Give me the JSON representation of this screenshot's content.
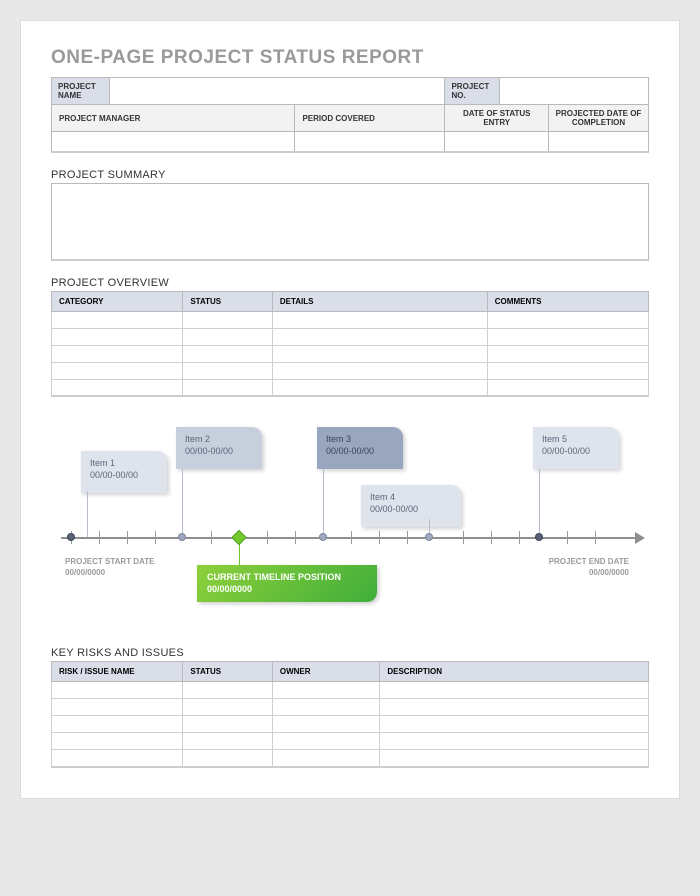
{
  "title": "ONE-PAGE PROJECT STATUS REPORT",
  "top": {
    "projectName": "PROJECT NAME",
    "projectNo": "PROJECT NO.",
    "projectManager": "PROJECT MANAGER",
    "periodCovered": "PERIOD COVERED",
    "dateOfStatus": "DATE OF STATUS ENTRY",
    "projCompletion": "PROJECTED DATE OF COMPLETION",
    "values": {
      "projectName": "",
      "projectNo": "",
      "projectManager": "",
      "periodCovered": "",
      "dateOfStatus": "",
      "projCompletion": ""
    }
  },
  "sections": {
    "summary": "PROJECT SUMMARY",
    "overview": "PROJECT OVERVIEW",
    "risks": "KEY RISKS AND ISSUES"
  },
  "overview": {
    "headers": {
      "category": "CATEGORY",
      "status": "STATUS",
      "details": "DETAILS",
      "comments": "COMMENTS"
    },
    "rows": [
      {
        "category": "",
        "status": "",
        "details": "",
        "comments": ""
      },
      {
        "category": "",
        "status": "",
        "details": "",
        "comments": ""
      },
      {
        "category": "",
        "status": "",
        "details": "",
        "comments": ""
      },
      {
        "category": "",
        "status": "",
        "details": "",
        "comments": ""
      },
      {
        "category": "",
        "status": "",
        "details": "",
        "comments": ""
      }
    ]
  },
  "timeline": {
    "items": [
      {
        "name": "Item 1",
        "range": "00/00-00/00"
      },
      {
        "name": "Item 2",
        "range": "00/00-00/00"
      },
      {
        "name": "Item 3",
        "range": "00/00-00/00"
      },
      {
        "name": "Item 4",
        "range": "00/00-00/00"
      },
      {
        "name": "Item 5",
        "range": "00/00-00/00"
      }
    ],
    "start": {
      "label": "PROJECT START DATE",
      "date": "00/00/0000"
    },
    "end": {
      "label": "PROJECT END DATE",
      "date": "00/00/0000"
    },
    "current": {
      "label": "CURRENT TIMELINE POSITION",
      "date": "00/00/0000"
    }
  },
  "risks": {
    "headers": {
      "name": "RISK / ISSUE NAME",
      "status": "STATUS",
      "owner": "OWNER",
      "description": "DESCRIPTION"
    },
    "rows": [
      {
        "name": "",
        "status": "",
        "owner": "",
        "description": ""
      },
      {
        "name": "",
        "status": "",
        "owner": "",
        "description": ""
      },
      {
        "name": "",
        "status": "",
        "owner": "",
        "description": ""
      },
      {
        "name": "",
        "status": "",
        "owner": "",
        "description": ""
      },
      {
        "name": "",
        "status": "",
        "owner": "",
        "description": ""
      }
    ]
  }
}
